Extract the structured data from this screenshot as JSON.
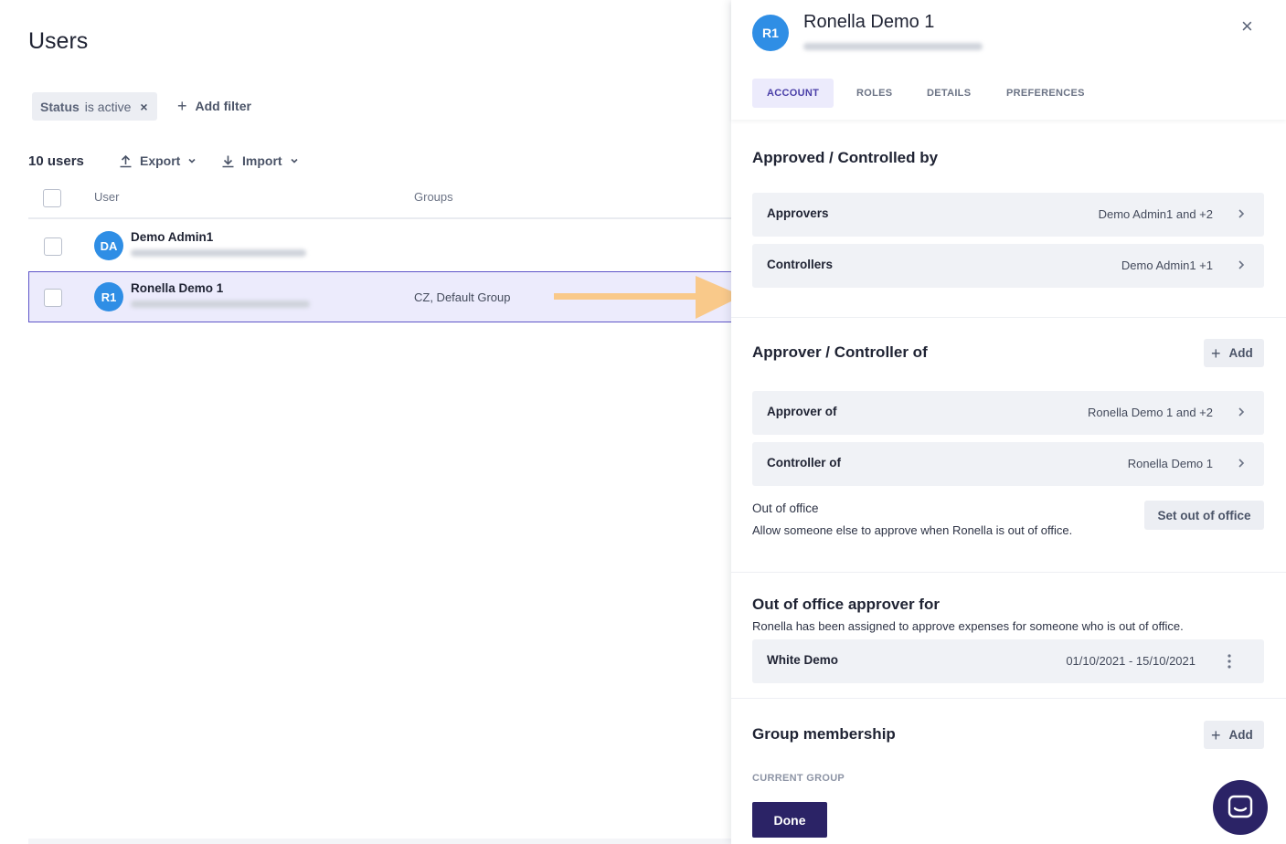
{
  "page": {
    "title": "Users",
    "filter": {
      "key": "Status",
      "value": "is active",
      "remove": "×"
    },
    "add_filter": "Add filter",
    "count": "10 users",
    "export": "Export",
    "import": "Import",
    "columns": {
      "user": "User",
      "groups": "Groups"
    },
    "rows": [
      {
        "initials": "DA",
        "name": "Demo Admin1",
        "groups": ""
      },
      {
        "initials": "R1",
        "name": "Ronella Demo 1",
        "groups": "CZ, Default Group"
      }
    ]
  },
  "drawer": {
    "initials": "R1",
    "name": "Ronella Demo 1",
    "close": "×",
    "tabs": [
      "ACCOUNT",
      "ROLES",
      "DETAILS",
      "PREFERENCES"
    ],
    "approved_controlled_by": {
      "title": "Approved / Controlled by",
      "rows": [
        {
          "label": "Approvers",
          "value": "Demo Admin1 and +2"
        },
        {
          "label": "Controllers",
          "value": "Demo Admin1 +1"
        }
      ]
    },
    "approver_controller_of": {
      "title": "Approver / Controller of",
      "add": "Add",
      "rows": [
        {
          "label": "Approver of",
          "value": "Ronella Demo 1 and +2"
        },
        {
          "label": "Controller of",
          "value": "Ronella Demo 1"
        }
      ]
    },
    "out_of_office": {
      "label": "Out of office",
      "description": "Allow someone else to approve when Ronella is out of office.",
      "button": "Set out of office"
    },
    "ooo_approver_for": {
      "title": "Out of office approver for",
      "description": "Ronella has been assigned to approve expenses for someone who is out of office.",
      "row": {
        "label": "White Demo",
        "value": "01/10/2021 - 15/10/2021"
      }
    },
    "group_membership": {
      "title": "Group membership",
      "add": "Add",
      "current_group": "CURRENT GROUP"
    },
    "done": "Done"
  },
  "colors": {
    "accent": "#2b2366",
    "avatar": "#2f8ee5",
    "selected_row": "#ecebfc",
    "arrow": "#f9c98a"
  }
}
